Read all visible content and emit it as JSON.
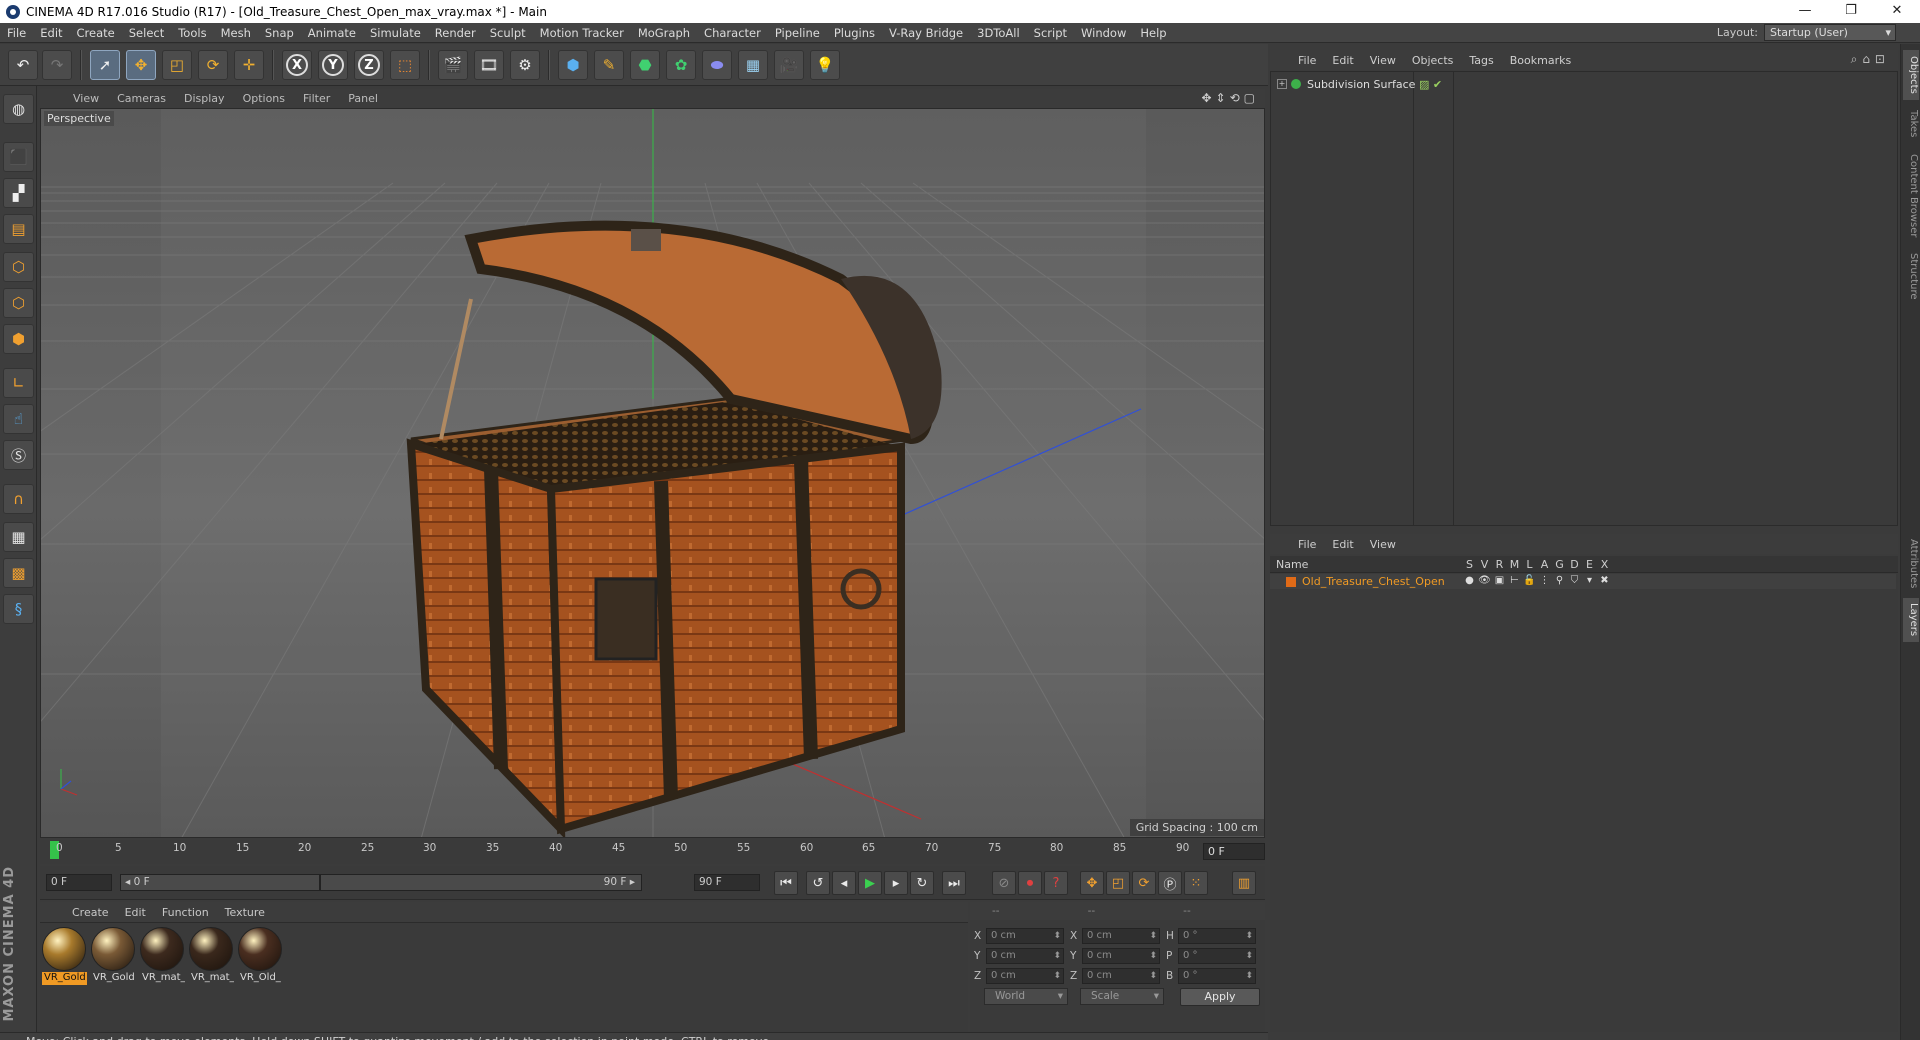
{
  "titlebar": {
    "title": "CINEMA 4D R17.016 Studio (R17) - [Old_Treasure_Chest_Open_max_vray.max *] - Main",
    "minimize": "—",
    "restore": "❐",
    "close": "✕"
  },
  "menubar": {
    "items": [
      "File",
      "Edit",
      "Create",
      "Select",
      "Tools",
      "Mesh",
      "Snap",
      "Animate",
      "Simulate",
      "Render",
      "Sculpt",
      "Motion Tracker",
      "MoGraph",
      "Character",
      "Pipeline",
      "Plugins",
      "V-Ray Bridge",
      "3DToAll",
      "Script",
      "Window",
      "Help"
    ],
    "layout_label": "Layout:",
    "layout_value": "Startup (User)"
  },
  "toolbar": {
    "axis_x": "X",
    "axis_y": "Y",
    "axis_z": "Z"
  },
  "viewport": {
    "menu": [
      "View",
      "Cameras",
      "Display",
      "Options",
      "Filter",
      "Panel"
    ],
    "label": "Perspective",
    "grid_spacing": "Grid Spacing : 100 cm",
    "nav_icons": "✥⇕⟲▢"
  },
  "timeline": {
    "ticks": [
      "0",
      "5",
      "10",
      "15",
      "20",
      "25",
      "30",
      "35",
      "40",
      "45",
      "50",
      "55",
      "60",
      "65",
      "70",
      "75",
      "80",
      "85",
      "90"
    ],
    "current_frame": "0 F"
  },
  "transport": {
    "start_field": "0 F",
    "slider_left": "◂ 0 F",
    "slider_right": "90 F ▸",
    "end_field": "90 F"
  },
  "materials": {
    "menu": [
      "Create",
      "Edit",
      "Function",
      "Texture"
    ],
    "items": [
      {
        "label": "VR_Gold",
        "selected": true,
        "color": "#a87a2c"
      },
      {
        "label": "VR_Gold",
        "selected": false,
        "color": "#7a5a36"
      },
      {
        "label": "VR_mat_",
        "selected": false,
        "color": "#3d2a1e"
      },
      {
        "label": "VR_mat_",
        "selected": false,
        "color": "#3a281c"
      },
      {
        "label": "VR_Old_",
        "selected": false,
        "color": "#4a2e20"
      }
    ]
  },
  "coordinates": {
    "header": [
      "--",
      "--",
      "--"
    ],
    "rows": [
      {
        "a": "X",
        "av": "0 cm",
        "b": "X",
        "bv": "0 cm",
        "c": "H",
        "cv": "0 °"
      },
      {
        "a": "Y",
        "av": "0 cm",
        "b": "Y",
        "bv": "0 cm",
        "c": "P",
        "cv": "0 °"
      },
      {
        "a": "Z",
        "av": "0 cm",
        "b": "Z",
        "bv": "0 cm",
        "c": "B",
        "cv": "0 °"
      }
    ],
    "mode": "World",
    "size_mode": "Scale",
    "apply": "Apply"
  },
  "status": {
    "text": "Move: Click and drag to move elements. Hold down SHIFT to quantize movement / add to the selection in point mode, CTRL to remove."
  },
  "object_manager": {
    "menu": [
      "File",
      "Edit",
      "View",
      "Objects",
      "Tags",
      "Bookmarks"
    ],
    "object_name": "Subdivision Surface",
    "tags": "▨ ✔"
  },
  "layer_manager": {
    "menu": [
      "File",
      "Edit",
      "View"
    ],
    "name_header": "Name",
    "flags": [
      "S",
      "V",
      "R",
      "M",
      "L",
      "A",
      "G",
      "D",
      "E",
      "X"
    ],
    "layer_name": "Old_Treasure_Chest_Open",
    "layer_color": "#e06a17"
  },
  "side_tabs": [
    "Objects",
    "Takes",
    "Content Browser",
    "Structure",
    "Attributes",
    "Layers"
  ],
  "brand": "MAXON CINEMA 4D"
}
